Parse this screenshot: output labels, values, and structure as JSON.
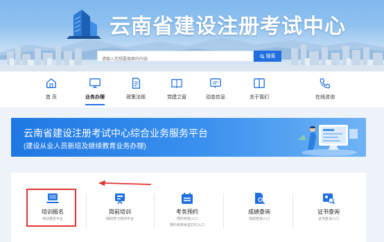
{
  "header": {
    "site_title": "云南省建设注册考试中心",
    "search_placeholder": "请输入您想要搜索的内容",
    "search_button": "搜索",
    "search_icon": "search-icon"
  },
  "nav": {
    "items": [
      {
        "label": "首  页",
        "icon": "home-icon"
      },
      {
        "label": "业务办理",
        "icon": "monitor-icon"
      },
      {
        "label": "政策法规",
        "icon": "document-icon"
      },
      {
        "label": "党建之窗",
        "icon": "book-icon"
      },
      {
        "label": "动态信息",
        "icon": "message-icon"
      },
      {
        "label": "关于我们",
        "icon": "panel-icon"
      },
      {
        "label": "在线咨询",
        "icon": "phone-icon"
      }
    ],
    "active": "业务办理"
  },
  "banner": {
    "title": "云南省建设注册考试中心综合业务服务平台",
    "subtitle": "(建设从业人员新培及继续教育业务办理)"
  },
  "services": [
    {
      "title": "培训报名",
      "subtitle": "培训报名平台",
      "subtitle2": "",
      "icon": "laptop-icon"
    },
    {
      "title": "岗前培训",
      "subtitle": "岗前学习培训平台",
      "subtitle2": "",
      "icon": "presentation-icon"
    },
    {
      "title": "考务预约",
      "subtitle": "预约考核入口",
      "subtitle2": "预约考核考证打印入口",
      "icon": "calendar-icon"
    },
    {
      "title": "成绩查询",
      "subtitle": "成绩查询入口",
      "subtitle2": "",
      "icon": "doc-search-icon"
    },
    {
      "title": "证书查询",
      "subtitle": "证书查询入口",
      "subtitle2": "",
      "icon": "certificate-search-icon"
    }
  ],
  "colors": {
    "primary": "#1f6fe0",
    "highlight": "#e43232",
    "banner_start": "#1f78e3",
    "banner_end": "#6fb3f5"
  }
}
